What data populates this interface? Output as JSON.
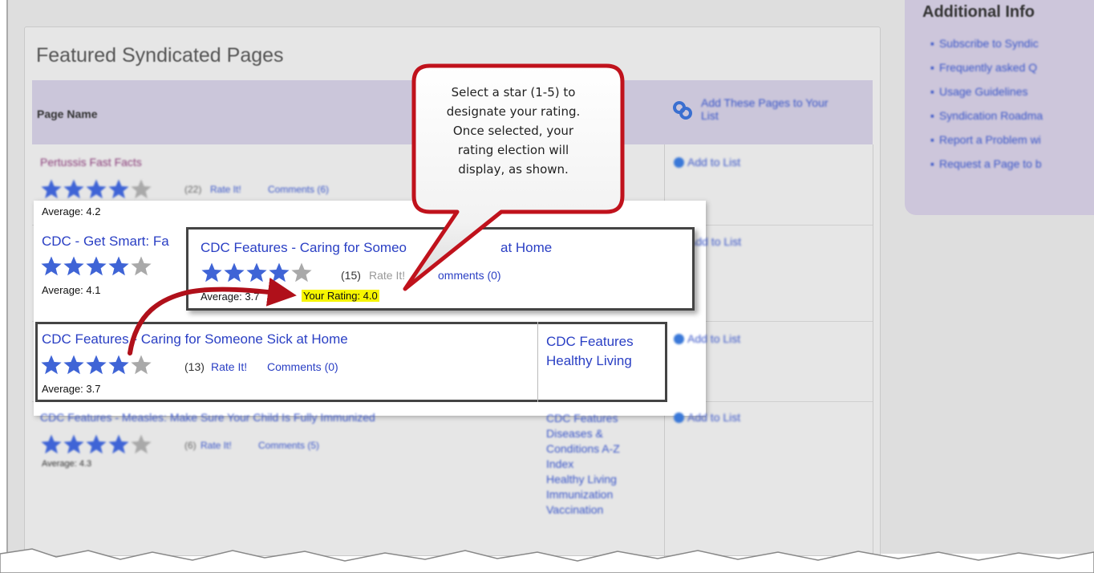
{
  "sidebar": {
    "title": "Additional Info",
    "items": [
      {
        "label": "Subscribe to Syndic"
      },
      {
        "label": "Frequently asked Q"
      },
      {
        "label": "Usage Guidelines"
      },
      {
        "label": "Syndication Roadma"
      },
      {
        "label": "Report a Problem wi"
      },
      {
        "label": "Request a Page to b"
      }
    ]
  },
  "panel": {
    "title": "Featured Syndicated Pages",
    "col_page_name": "Page Name",
    "add_pages": "Add These Pages to Your List",
    "add_to_list": "Add to List"
  },
  "background_rows": [
    {
      "title": "Pertussis Fast Facts",
      "count": "(22)",
      "rate": "Rate It!",
      "comments": "Comments (6)",
      "average": "Average: 4.2",
      "rating": 4
    },
    {
      "title": "CDC - Get Smart: Fa",
      "count": "(",
      "average": "Average: 4.1",
      "rating": 4
    },
    {
      "title": "CDC Features - Measles: Make Sure Your Child Is Fully Immunized",
      "count": "(6)",
      "rate": "Rate It!",
      "comments": "Comments (5)",
      "average": "Average: 4.3",
      "rating": 4,
      "categories": [
        "CDC Features",
        "Diseases &",
        "Conditions A-Z",
        "Index",
        "Healthy Living",
        "Immunization",
        "Vaccination"
      ]
    }
  ],
  "highlight_row": {
    "title": "CDC Features - Caring for Someone Sick at Home",
    "count": "(13)",
    "rate": "Rate It!",
    "comments": "Comments (0)",
    "average": "Average: 3.7",
    "rating": 4,
    "categories": [
      "CDC Features",
      "Healthy Living"
    ]
  },
  "popup_row": {
    "title_part1": "CDC Features - Caring for Someo",
    "title_part2": "at Home",
    "count": "(15)",
    "rate": "Rate It!",
    "comments": "omments (0)",
    "average": "Average: 3.7",
    "your_rating": "Your Rating: 4.0",
    "rating": 4
  },
  "callout": {
    "lines": [
      "Select a star (1-5) to",
      "designate your rating.",
      "Once selected, your",
      "rating election will",
      "display, as shown."
    ]
  },
  "colors": {
    "star_filled": "#3f64d6",
    "star_empty": "#a9a9a9",
    "callout_red": "#c0121c",
    "highlight_yellow": "#f6f500",
    "link_blue": "#2a3fc4"
  },
  "icons": [
    "star-icon",
    "link-chain-icon",
    "add-circle-icon",
    "curved-arrow-icon"
  ]
}
